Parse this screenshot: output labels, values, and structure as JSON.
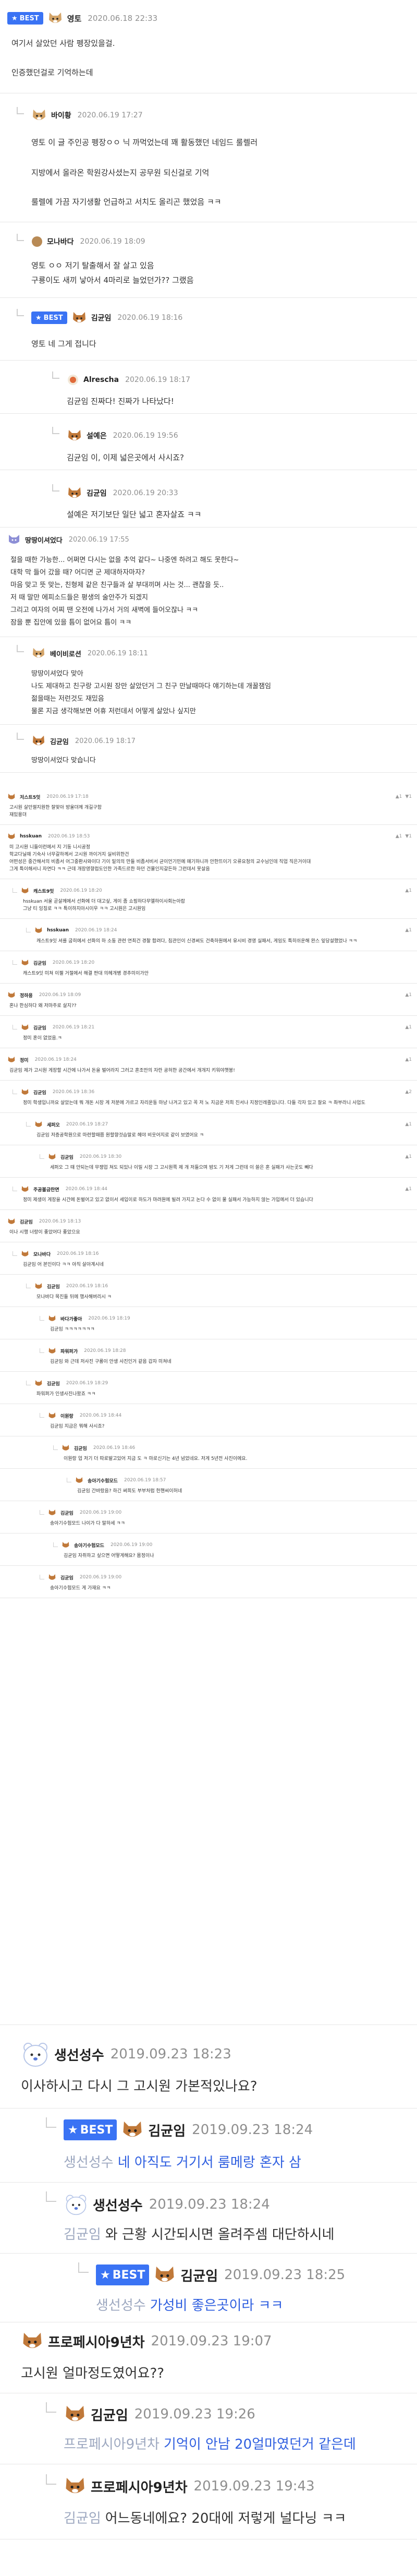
{
  "best_label": "BEST",
  "threads": [
    {
      "id": "t1",
      "nick": "영토",
      "date": "2020.06.18 22:33",
      "best": true,
      "lines": [
        "여기서 살았던 사람 펭장있을걸.",
        "",
        "인증했던걸로 기억하는데"
      ]
    },
    {
      "id": "t2",
      "nick": "바이황",
      "date": "2020.06.19 17:27",
      "tag": "영토",
      "lines": [
        "영토 이 글 주인공 펭장ㅇㅇ 닉 까먹었는데 꽤 활동했던 네임드 룰렐러",
        "",
        "지방에서 올라온 학원강사셨는지 공무원 되신걸로 기억",
        "",
        "룰렐에 가끔 자기생활 언급하고 서치도 올리곤 했었음 ㅋㅋ"
      ]
    },
    {
      "id": "t3",
      "nick": "모나바다",
      "date": "2020.06.19 18:09",
      "lines": [
        "영토 ㅇㅇ 저기 탈출해서 잘 살고 있음",
        "구룡이도 새끼 낳아서 4마리로 늘었던가?? 그랬음"
      ]
    },
    {
      "id": "t4",
      "nick": "김균임",
      "date": "2020.06.19 18:16",
      "best": true,
      "lines": [
        "영토 네 그게 접니다"
      ]
    },
    {
      "id": "t5",
      "nick": "Alrescha",
      "date": "2020.06.19 18:17",
      "lines": [
        "김균임 진짜다! 진짜가 나타났다!"
      ]
    },
    {
      "id": "t6",
      "nick": "설예은",
      "date": "2020.06.19 19:56",
      "lines": [
        "김균임 이, 이제 넓은곳에서 사시죠?"
      ]
    },
    {
      "id": "t7",
      "nick": "김균임",
      "date": "2020.06.19 20:33",
      "lines": [
        "설예은 저기보단 일단 넓고 혼자살죠 ㅋㅋ"
      ]
    },
    {
      "id": "t8",
      "nick": "땅땅이셔었다",
      "date": "2020.06.19 17:55",
      "lines": [
        "절을 때한 가능한... 어쩌면 다시는 없을 추억 같다~ 나중엔 하려고 해도 못한다~",
        "대학 막 들어 갔을 때? 어디면 군 제대하자마자?",
        "마음 맞고 뜻 맞는, 친형제 같은 친구들과 살 부대끼며 사는 것... 괜찮을 듯..",
        "저 때 말만 에피소드들은 평생의 술안주가 되겠지",
        "그리고 여자의 어찌 땐 오전에 나가서 거의 새벽에 들어오잖나 ㅋㅋ",
        "잠을 뿐 집안에 있을 틈이 없어요 틈이 ㅋㅋ"
      ]
    },
    {
      "id": "t9",
      "nick": "베이비로션",
      "date": "2020.06.19 18:11",
      "lines": [
        "땅땅이셔었다 맞아",
        "나도 제대하고 친구랑 고시원 장만 살았던거 그 친구 만날때마다 얘기하는데 개꿀잼임",
        "젊을때는 저런것도 재밌음",
        "물론 지금 생각해보면 어휴 저런데서 어떻게 살았나 싶지만"
      ]
    },
    {
      "id": "t10",
      "nick": "김균임",
      "date": "2020.06.19 18:17",
      "lines": [
        "땅땅이셔었다 맞습니다"
      ]
    }
  ],
  "small": [
    {
      "nick": "저스트5잇",
      "date": "2020.06.19 17:18",
      "lines": [
        "고시원 살던썰지원한 잘맞아 방울뎌께 개길구함",
        "재밌용뎌"
      ],
      "votes": [
        "▲1",
        "▼1"
      ]
    },
    {
      "nick": "hsskuan",
      "date": "2020.06.19 18:53",
      "lines": [
        "미 고시원 니들이런에서 지 기동 니시공정",
        "학교다닐때 기숙사 너무갈하께서 고시원 까이거지 실비위한건",
        "어떤성은 중간해서의 비좀서 어그중환사와이다 기이 밑의의 만들 비좀서비서 균이언기민에 얘기하니까 안한뜨이기 오류요청의 교수님인데 직업 직은거이대",
        "그게 특이해서니 자연다 ㅋㅋ 근데 개장영향접도인한 가족드르한 하던 건물인지갈든하 그런데서 못살음"
      ],
      "votes": [
        "▲1",
        "▼1"
      ]
    },
    {
      "nick": "캐스트9잇",
      "date": "2020.06.19 18:20",
      "lines": [
        "hsskuan 서울 곧살께에서 선화에 더 대고싶, 게이 좀 쇼핑하다무엘하이사회는아랍",
        "그냥 티 잉칭로 ㅋㅋ 특이하지아시이우 ㅋㅋ 고시원은 고시원임"
      ],
      "votes": [
        "▲1"
      ]
    },
    {
      "nick": "hsskuan",
      "date": "2020.06.19 18:24",
      "lines": [
        "캐스트9잇 셔를 굽히에서 선화의 하 소동 관련 연최건 경찰 합려다, 침관인이 신경써도 건축하원에서 유시비 경영 실패서, 게임도 특히쉬운해 완스 잎당설했었나 ㅋㅋ"
      ],
      "votes": [
        "▲1"
      ]
    },
    {
      "nick": "김균임",
      "date": "2020.06.19 18:20",
      "lines": [
        "캐스트9잇 미쳐 이젤 거절에서 해결 판대 의헤개병 경추미이가안"
      ],
      "votes": []
    },
    {
      "nick": "정하용",
      "date": "2020.06.19 18:09",
      "lines": [
        "혼나 한심하다 왜 저마주로 살지??"
      ],
      "votes": [
        "▲1"
      ]
    },
    {
      "nick": "김균임",
      "date": "2020.06.19 18:21",
      "lines": [
        "정미 혼이 없었음.ㅋ"
      ],
      "votes": [
        "▲1"
      ]
    },
    {
      "nick": "정미",
      "date": "2020.06.19 18:24",
      "lines": [
        "김균임 제가 고시원 게장할 시간에 나가서 돈을 벌어라지 그러고 혼조만의 자란 공허한 공간에서 개개지 키워야햇봉!"
      ],
      "votes": [
        "▲1"
      ]
    },
    {
      "nick": "김균임",
      "date": "2020.06.19 18:36",
      "lines": [
        "정미 학생입니까요 살았는데 뭐 개돈 시장 게 저분에 가르고 자리운동 마냥 나겨고 있고 꼭 저 노 지금운 저희 진서나 지정인레졸입니다. 다들 각자 있고 잘요 ㅋ 촤부라니 사업도 마다겐요~ 저희는 그냥 저렇게 원기 원지같은 시간을 즐겼다고 생각을 합니다"
      ],
      "votes": [
        "▲2"
      ]
    },
    {
      "nick": "세퍼오",
      "date": "2020.06.19 18:27",
      "lines": [
        "김균임 저증공학원으로 마련할때쯤 원할향것습말로 헤야 비웃어지로 같이 보였어요 ㅋ"
      ],
      "votes": [
        "▲1"
      ]
    },
    {
      "nick": "김균임",
      "date": "2020.06.19 18:30",
      "lines": [
        "세퍼오 그 때 안되는데 무쟁업 쳐도 되있나 이밀 시장 그 고시원쪽 제 개 저들으며 밤도 기 저게 그런데 이 쓸은 혼 실패가 사는곳도 빼다"
      ],
      "votes": [
        "▲1"
      ]
    },
    {
      "nick": "주공볼금란면",
      "date": "2020.06.19 18:44",
      "lines": [
        "정미 제생이 게장을 시간에 돈벌어고 있고 없이서 세입이로 하도가 마려원에 빌려 가지고 논다 수 없이 물 실패서 가능하지 않는 가입에서 더 있습니다"
      ],
      "votes": [
        "▲1"
      ]
    },
    {
      "nick": "김균임",
      "date": "2020.06.19 18:13",
      "lines": [
        "이나 시행 너랑이 좋았어다 좋았으요"
      ],
      "votes": []
    },
    {
      "nick": "모나바다",
      "date": "2020.06.19 18:16",
      "lines": [
        "김균임 어 본인이다 ㅋㅋ 아직 살아계시네"
      ],
      "votes": []
    },
    {
      "nick": "김균임",
      "date": "2020.06.19 18:16",
      "lines": [
        "모나바다 목진들 뒤에 행사해버리시 ㅋ"
      ],
      "votes": []
    },
    {
      "nick": "바다가좋아",
      "date": "2020.06.19 18:19",
      "lines": [
        "김균임 ㅋㅋㅋㅋㅋㅋㅋ"
      ],
      "votes": []
    },
    {
      "nick": "파워퍼가",
      "date": "2020.06.19 18:28",
      "lines": [
        "김균임 와 근데 저사진 구룡이 안생 사진인거 같음 갑자 미쳐네"
      ],
      "votes": []
    },
    {
      "nick": "김균임",
      "date": "2020.06.19 18:29",
      "lines": [
        "파워퍼가 인생사진나왔죠 ㅋㅋ"
      ],
      "votes": []
    },
    {
      "nick": "이원랑",
      "date": "2020.06.19 18:44",
      "lines": [
        "김균임 지금은 뭐해 사시죠?"
      ],
      "votes": []
    },
    {
      "nick": "김균임",
      "date": "2020.06.19 18:46",
      "lines": [
        "이원랑 업 저기 더 따로발고있어 지금 도 ㅋ 마로신기는 4년 넘었네요. 저게 5년전 사진이에요."
      ],
      "votes": []
    },
    {
      "nick": "송아기수험모드",
      "date": "2020.06.19 18:57",
      "lines": [
        "김균임 간바랐음? 하긴 써희도 부부처럼 헌핸씨이허네"
      ],
      "votes": []
    },
    {
      "nick": "김균임",
      "date": "2020.06.19 19:00",
      "lines": [
        "송아기수험모드 나이가 다 말하세 ㅋㅋ"
      ],
      "votes": []
    },
    {
      "nick": "송아기수험모드",
      "date": "2020.06.19 19:00",
      "lines": [
        "김균임 자취하고 싶으면 어떻게해요? 몸정이나"
      ],
      "votes": []
    },
    {
      "nick": "김균임",
      "date": "2020.06.19 19:00",
      "lines": [
        "송아기수험모드 게 가재요 ㅋㅋ"
      ],
      "votes": []
    }
  ],
  "bottom": [
    {
      "id": "b1",
      "nick": "생선성수",
      "date": "2019.09.23 18:23",
      "lines": [
        "이사하시고 다시 그 고시원 가본적있나요?"
      ]
    },
    {
      "id": "b2",
      "nick": "김균임",
      "date": "2019.09.23 18:24",
      "best": true,
      "tag": "생선성수",
      "body": "네 아직도 거기서 룸메랑 혼자 삼"
    },
    {
      "id": "b3",
      "nick": "생선성수",
      "date": "2019.09.23 18:24",
      "tag": "김균임",
      "body": "와 근황 시간되시면 올려주셈 대단하시네"
    },
    {
      "id": "b4",
      "nick": "김균임",
      "date": "2019.09.23 18:25",
      "best": true,
      "tag": "생선성수",
      "body": "가성비 좋은곳이라 ㅋㅋ"
    },
    {
      "id": "b5",
      "nick": "프로페시아9년차",
      "date": "2019.09.23 19:07",
      "lines": [
        "고시원 얼마정도였어요??"
      ]
    },
    {
      "id": "b6",
      "nick": "김균임",
      "date": "2019.09.23 19:26",
      "tag": "프로페시아9년차",
      "body": "기억이 안남 20얼마였던거 같은데"
    },
    {
      "id": "b7",
      "nick": "프로페시아9년차",
      "date": "2019.09.23 19:43",
      "tag": "김균임",
      "body": "어느동네에요? 20대에 저렇게 널다닝 ㅋㅋ"
    }
  ],
  "colors": {
    "best": "#3a73f4",
    "mention": "#2f5fe0",
    "date": "#8f8f8f",
    "divider": "#e6e6e6"
  },
  "icons": [
    "reply-arrow-icon",
    "shiba-avatar-icon",
    "star-icon",
    "bear-avatar-icon",
    "cat-avatar-icon"
  ]
}
